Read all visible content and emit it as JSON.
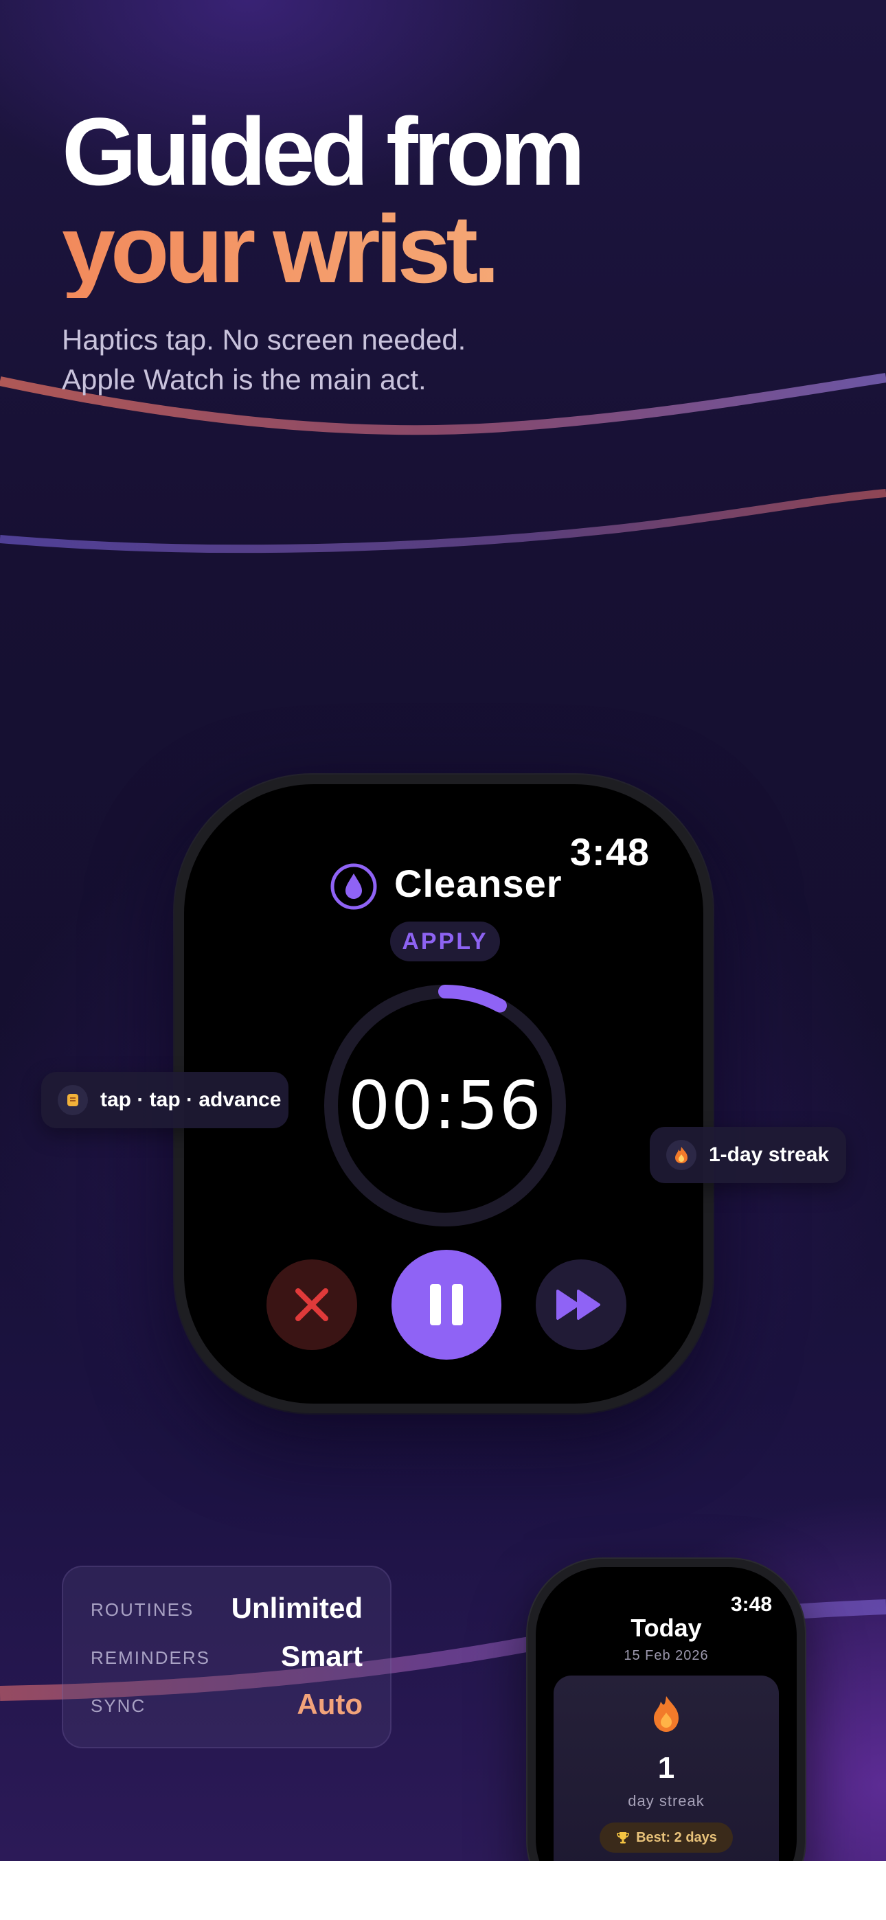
{
  "headline": {
    "line1": "Guided from",
    "line2": "your wrist."
  },
  "subtitle": {
    "line1": "Haptics tap. No screen needed.",
    "line2": "Apple Watch is the main act."
  },
  "watch_main": {
    "time": "3:48",
    "step_title": "Cleanser",
    "step_icon": "droplet-icon",
    "phase": "APPLY",
    "countdown": "00:56",
    "ring_progress": 0.08,
    "buttons": {
      "cancel": "close-icon",
      "pause": "pause-icon",
      "skip": "fast-forward-icon"
    }
  },
  "chips": {
    "haptics": {
      "icon": "haptic-icon",
      "label": "tap · tap · advance"
    },
    "streak": {
      "icon": "flame-icon",
      "label": "1-day streak"
    }
  },
  "plan": {
    "rows": [
      {
        "label": "ROUTINES",
        "value": "Unlimited"
      },
      {
        "label": "REMINDERS",
        "value": "Smart"
      },
      {
        "label": "SYNC",
        "value": "Auto"
      }
    ]
  },
  "watch_small": {
    "time": "3:48",
    "title": "Today",
    "date": "15 Feb 2026",
    "streak_count": "1",
    "streak_unit": "day streak",
    "best": "Best: 2 days",
    "best_icon": "trophy-icon"
  },
  "colors": {
    "accent_purple": "#8f63f5",
    "accent_orange": "#f4a06c",
    "cancel_red": "#e03a3a",
    "background": "#171033"
  }
}
